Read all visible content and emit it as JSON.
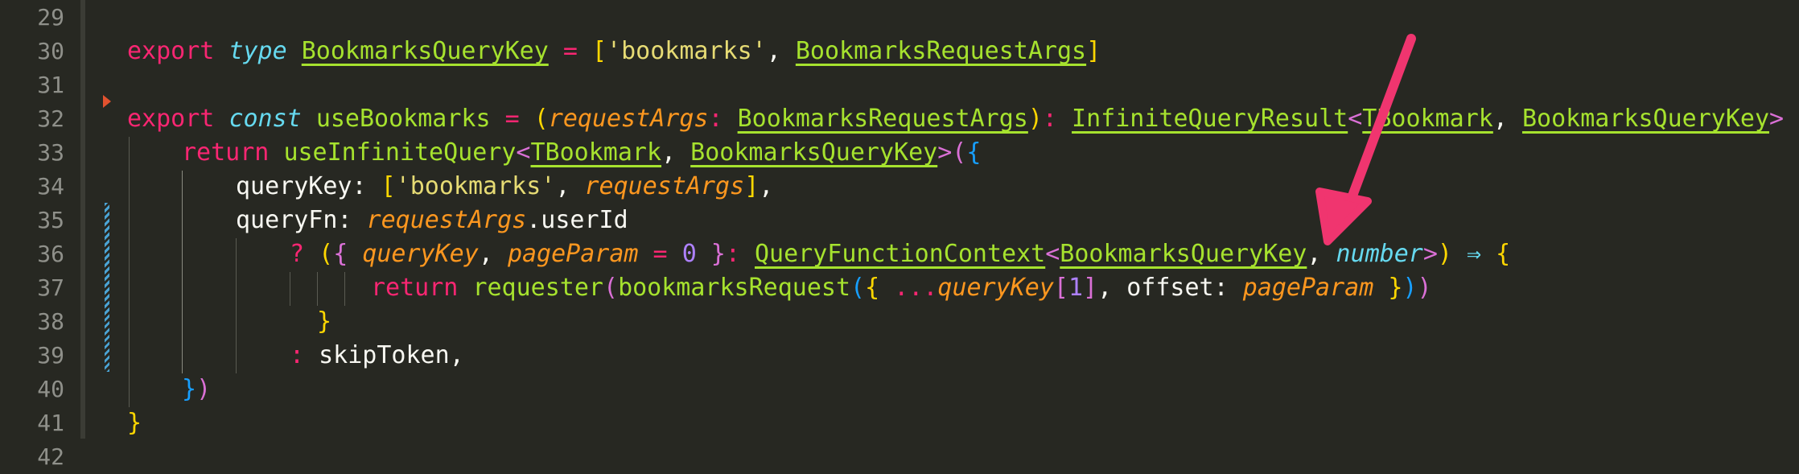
{
  "gutter": {
    "line_numbers": [
      "29",
      "30",
      "31",
      "32",
      "33",
      "34",
      "35",
      "36",
      "37",
      "38",
      "39",
      "40",
      "41",
      "42"
    ]
  },
  "code": {
    "line30": {
      "kw_export": "export",
      "kw_type": "type",
      "name": "BookmarksQueryKey",
      "eq": " = ",
      "open": "[",
      "str": "'bookmarks'",
      "comma": ", ",
      "ref": "BookmarksRequestArgs",
      "close": "]"
    },
    "line32": {
      "kw_export": "export",
      "kw_const": "const",
      "name": "useBookmarks",
      "eq": " = ",
      "open": "(",
      "param": "requestArgs",
      "colon": ": ",
      "param_type": "BookmarksRequestArgs",
      "close": ")",
      "colon2": ": ",
      "ret_type": "InfiniteQueryResult",
      "lt": "<",
      "gen1": "TBookmark",
      "comma": ", ",
      "gen2": "BookmarksQueryKey",
      "gt": ">",
      "arrow": " ⇒ ",
      "brace": "{"
    },
    "line33": {
      "kw_return": "return",
      "fn": "useInfiniteQuery",
      "lt": "<",
      "gen1": "TBookmark",
      "comma": ", ",
      "gen2": "BookmarksQueryKey",
      "gt": ">",
      "open": "(",
      "brace": "{"
    },
    "line34": {
      "prop": "queryKey: ",
      "open": "[",
      "str": "'bookmarks'",
      "comma": ", ",
      "param": "requestArgs",
      "close": "]",
      "trail": ","
    },
    "line35": {
      "prop": "queryFn: ",
      "param": "requestArgs",
      "member": ".userId"
    },
    "line36": {
      "q": "? ",
      "open": "(",
      "brace": "{ ",
      "p1": "queryKey",
      "comma": ", ",
      "p2": "pageParam",
      "eq": " = ",
      "zero": "0",
      "brace_close": " }",
      "colon": ": ",
      "ctx": "QueryFunctionContext",
      "lt": "<",
      "gen1": "BookmarksQueryKey",
      "comma2": ", ",
      "gen2": "number",
      "gt": ">",
      "close": ")",
      "arrow": " ⇒ ",
      "brace2": "{"
    },
    "line37": {
      "kw_return": "return",
      "fn1": "requester",
      "open1": "(",
      "fn2": "bookmarksRequest",
      "open2": "(",
      "brace": "{ ",
      "spread": "...",
      "param": "queryKey",
      "idx_open": "[",
      "idx": "1",
      "idx_close": "]",
      "comma": ", ",
      "prop": "offset: ",
      "param2": "pageParam",
      "brace_close": " }",
      "close2": ")",
      "close1": ")"
    },
    "line38": {
      "brace": "}"
    },
    "line39": {
      "colon": ": ",
      "value": "skipToken",
      "trail": ","
    },
    "line40": {
      "brace": "}",
      "close": ")"
    },
    "line41": {
      "brace": "}"
    }
  },
  "colors": {
    "background": "#272822",
    "annotation_arrow": "#f0356f"
  },
  "icons": [
    "fold-arrow-icon",
    "annotation-arrow-icon"
  ]
}
